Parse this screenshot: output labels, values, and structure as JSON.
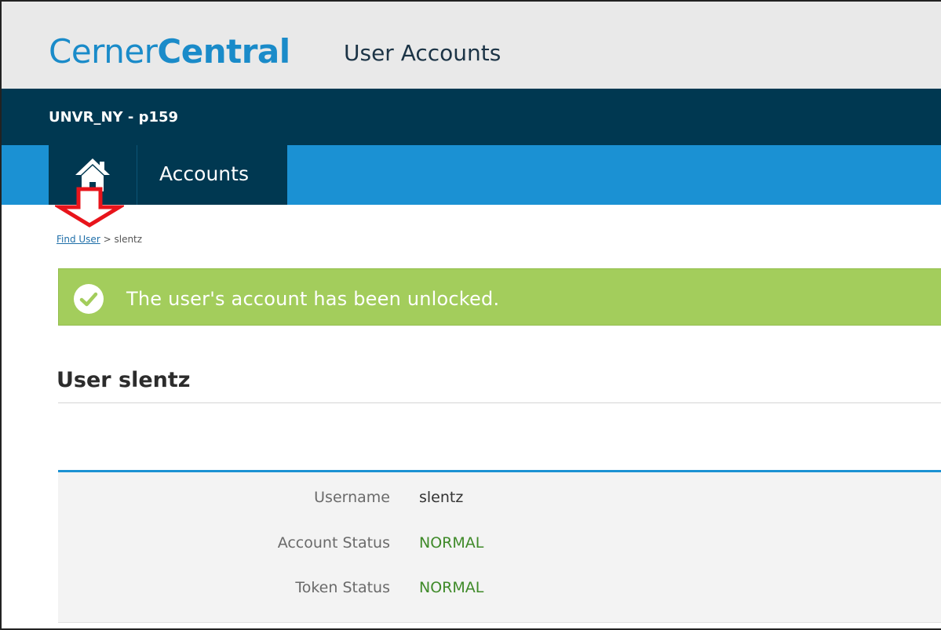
{
  "header": {
    "brand_light": "Cerner",
    "brand_bold": "Central",
    "subtitle": "User Accounts"
  },
  "org": {
    "name": "UNVR_NY - p159"
  },
  "nav": {
    "home_icon": "home-icon",
    "accounts_label": "Accounts"
  },
  "breadcrumb": {
    "link": "Find User",
    "separator": ">",
    "current": "slentz"
  },
  "alert": {
    "icon": "check-circle-icon",
    "message": "The user's account has been unlocked."
  },
  "user": {
    "title": "User slentz",
    "fields": [
      {
        "label": "Username",
        "value": "slentz"
      },
      {
        "label": "Account Status",
        "value": "NORMAL"
      },
      {
        "label": "Token Status",
        "value": "NORMAL"
      }
    ]
  },
  "colors": {
    "brand_blue": "#1a8bc9",
    "org_bar": "#003851",
    "nav_bar": "#1b91d3",
    "alert_green": "#a3cd5c",
    "status_green": "#3f8a29",
    "annotation_red": "#e8141b"
  }
}
